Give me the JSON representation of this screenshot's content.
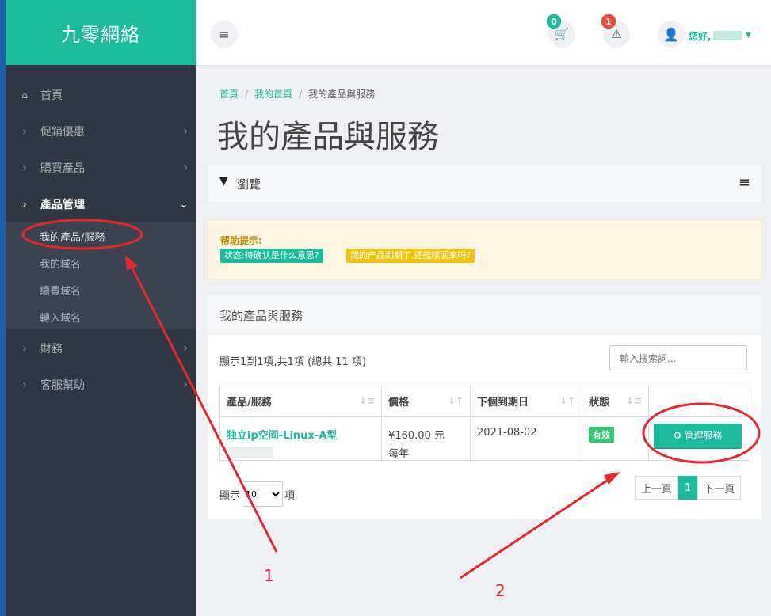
{
  "brand": "九零網絡",
  "sidebar": {
    "items": [
      {
        "icon": "home-icon",
        "glyph": "⌂",
        "label": "首頁"
      },
      {
        "icon": "chevron-right-icon",
        "glyph": "›",
        "label": "促銷優惠"
      },
      {
        "icon": "chevron-right-icon",
        "glyph": "›",
        "label": "購買產品"
      },
      {
        "icon": "chevron-right-icon",
        "glyph": "›",
        "label": "產品管理"
      },
      {
        "icon": "chevron-right-icon",
        "glyph": "›",
        "label": "財務"
      },
      {
        "icon": "chevron-right-icon",
        "glyph": "›",
        "label": "客服幫助"
      }
    ],
    "subitems": [
      "我的產品/服務",
      "我的域名",
      "續費域名",
      "轉入域名"
    ]
  },
  "topbar": {
    "cart_count": "0",
    "alert_count": "1",
    "greeting": "您好,"
  },
  "breadcrumb": {
    "home": "首頁",
    "mine": "我的首頁",
    "current": "我的產品與服務"
  },
  "page_title": "我的產品與服務",
  "filter": {
    "label": "瀏覽"
  },
  "help": {
    "title": "帮助提示:",
    "tag1": "状态:待确认是什么意思?",
    "tag2": "我的产品到期了,还能续回来吗?"
  },
  "list": {
    "title": "我的產品與服務",
    "info": "顯示1到1項,共1項 (總共 11 項)",
    "search_placeholder": "輸入搜索詞...",
    "columns": [
      "產品/服務",
      "價格",
      "下個到期日",
      "狀態"
    ],
    "rows": [
      {
        "product": "独立ip空间-Linux-A型",
        "price": "¥160.00 元",
        "cycle": "每年",
        "due": "2021-08-02",
        "status": "有效",
        "action": "管理服務"
      }
    ],
    "length_prefix": "顯示",
    "length_value": "10",
    "length_suffix": "項",
    "pager": {
      "prev": "上一頁",
      "page": "1",
      "next": "下一頁"
    }
  },
  "annotations": {
    "n1": "1",
    "n2": "2",
    "color": "#e8262d"
  },
  "colors": {
    "accent": "#1abc9c",
    "sidebar": "#2f3742",
    "warning": "#f1c40f",
    "danger": "#e74c3c"
  }
}
